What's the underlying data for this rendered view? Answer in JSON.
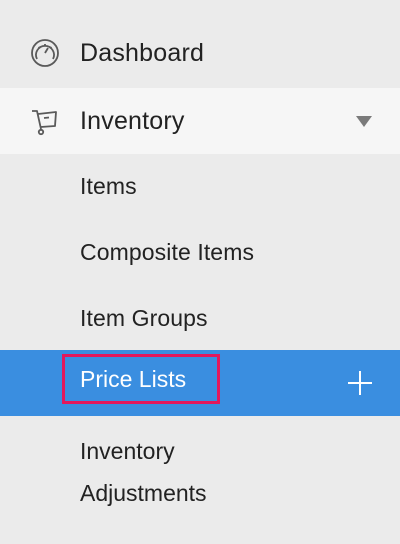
{
  "sidebar": {
    "dashboard": {
      "label": "Dashboard",
      "icon": "dashboard-gauge-icon"
    },
    "inventory": {
      "label": "Inventory",
      "icon": "cart-icon",
      "expanded": true
    },
    "items": [
      {
        "label": "Items"
      },
      {
        "label": "Composite Items"
      },
      {
        "label": "Item Groups"
      },
      {
        "label": "Price Lists",
        "selected": true,
        "action_icon": "plus-icon"
      }
    ],
    "inventory_adjustments": {
      "line1": "Inventory",
      "line2": "Adjustments"
    }
  },
  "colors": {
    "sidebar_bg": "#ebebeb",
    "expanded_bg": "#f6f6f6",
    "selected_bg": "#3a8ee0",
    "highlight_border": "#e3185c",
    "text": "#222222"
  }
}
